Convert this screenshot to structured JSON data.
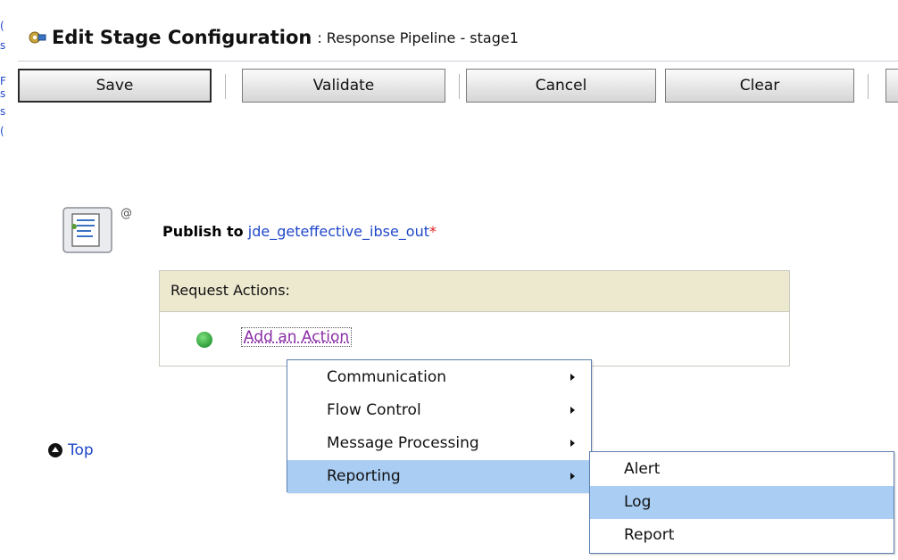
{
  "header": {
    "title": "Edit Stage Configuration",
    "subtitle": ": Response Pipeline - stage1"
  },
  "toolbar": {
    "save_label": "Save",
    "validate_label": "Validate",
    "cancel_label": "Cancel",
    "clear_label": "Clear"
  },
  "stage": {
    "at_sign": "@",
    "publish_label": "Publish to",
    "publish_target": "jde_geteffective_ibse_out",
    "required_mark": "*"
  },
  "request_actions": {
    "header": "Request Actions:",
    "add_action_label": "Add an Action"
  },
  "top_link": "Top",
  "context_menu": {
    "items": [
      {
        "label": "Communication",
        "has_submenu": true
      },
      {
        "label": "Flow Control",
        "has_submenu": true
      },
      {
        "label": "Message Processing",
        "has_submenu": true
      },
      {
        "label": "Reporting",
        "has_submenu": true,
        "selected": true
      }
    ]
  },
  "submenu": {
    "items": [
      {
        "label": "Alert"
      },
      {
        "label": "Log",
        "selected": true
      },
      {
        "label": "Report"
      }
    ]
  },
  "colors": {
    "link": "#1f47c9",
    "visited_link": "#8a2ea6",
    "menu_highlight": "#a9cdf3",
    "actions_header_bg": "#ede9cf",
    "required": "#e02020"
  },
  "icons": [
    "gear-pipeline-icon",
    "stage-document-icon",
    "green-dot-icon",
    "up-arrow-icon",
    "submenu-arrow-icon"
  ]
}
